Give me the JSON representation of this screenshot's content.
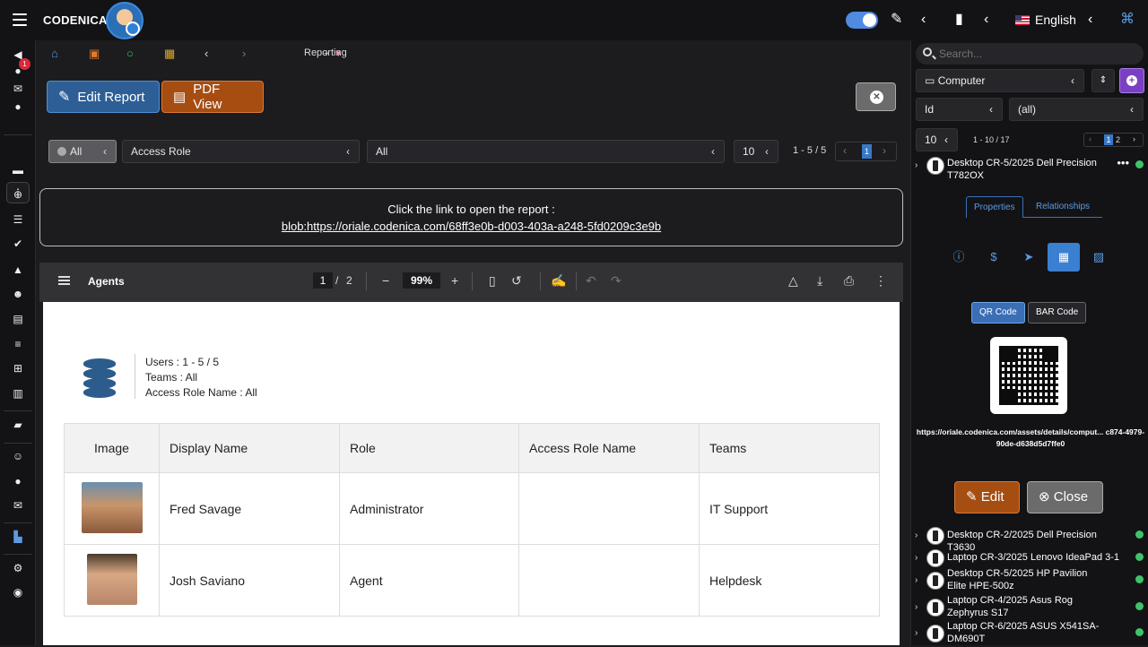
{
  "app": {
    "brand": "CODENICA",
    "language": "English"
  },
  "breadcrumb": {
    "current": "Reporting",
    "add": "+"
  },
  "toolbar": {
    "edit_report": "Edit Report",
    "pdf_view": "PDF View"
  },
  "filters": {
    "scope": "All",
    "field": "Access Role",
    "value": "All",
    "page_size": "10",
    "count": "1 - 5 / 5",
    "page": "1"
  },
  "link": {
    "title": "Click the link to open the report :",
    "url": "blob:https://oriale.codenica.com/68ff3e0b-d003-403a-a248-5fd0209c3e9b"
  },
  "pdf": {
    "title": "Agents",
    "page": "1",
    "total": "2",
    "sep": "/",
    "zoom": "99%",
    "info": [
      "Users : 1 - 5 / 5",
      "Teams : All",
      "Access Role Name : All"
    ],
    "columns": [
      "Image",
      "Display Name",
      "Role",
      "Access Role Name",
      "Teams"
    ],
    "rows": [
      {
        "name": "Fred Savage",
        "role": "Administrator",
        "access": "",
        "team": "IT Support"
      },
      {
        "name": "Josh Saviano",
        "role": "Agent",
        "access": "",
        "team": "Helpdesk"
      }
    ]
  },
  "right": {
    "search_placeholder": "Search...",
    "category": "Computer",
    "sort_field": "Id",
    "sort_value": "(all)",
    "page_size": "10",
    "count": "1 - 10 / 17",
    "pages": [
      "1",
      "2"
    ],
    "selected": "Desktop CR-5/2025 Dell Precision T782OX",
    "tabs": [
      "Properties",
      "Relationships"
    ],
    "code_tabs": [
      "QR Code",
      "BAR Code"
    ],
    "qr_url": "https://oriale.codenica.com/assets/details/comput... c874-4979-90de-d638d5d7ffe0",
    "edit": "Edit",
    "close": "Close",
    "items": [
      "Desktop CR-2/2025 Dell Precision T3630",
      "Laptop CR-3/2025 Lenovo IdeaPad 3-1",
      "Desktop CR-5/2025 HP Pavilion Elite HPE-500z",
      "Laptop CR-4/2025 Asus Rog Zephyrus S17",
      "Laptop CR-6/2025 ASUS X541SA-DM690T"
    ]
  },
  "sidebar": {
    "notification_count": "1"
  },
  "colors": {
    "accent": "#3779c8",
    "pdf_button": "#a64d12",
    "status_ok": "#3ec36b"
  }
}
